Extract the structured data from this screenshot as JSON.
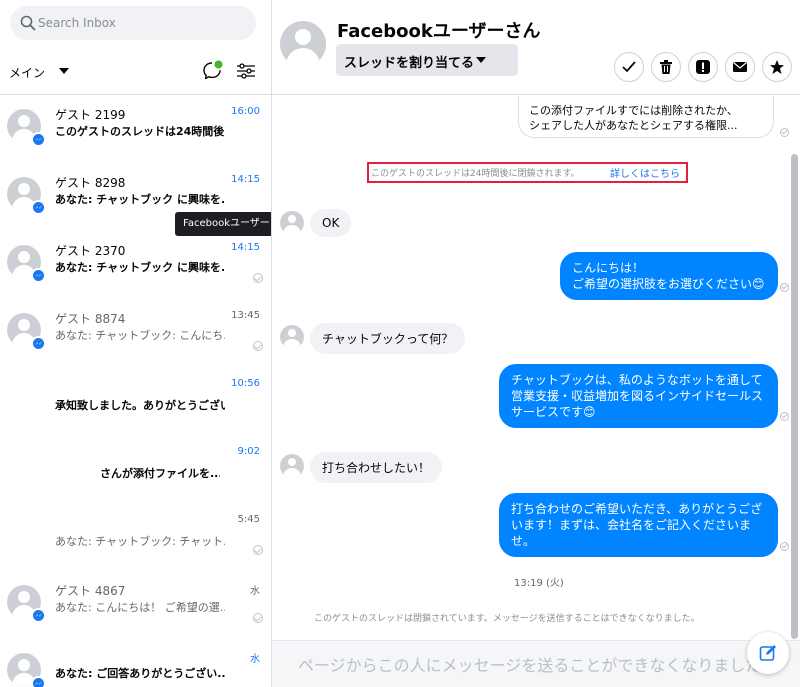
{
  "search": {
    "placeholder": "Search Inbox"
  },
  "filter": {
    "label": "メイン"
  },
  "conversations": [
    {
      "name": "ゲスト 2199",
      "preview": "このゲストのスレッドは24時間後...",
      "time": "16:00",
      "unread": true
    },
    {
      "name": "ゲスト 8298",
      "preview": "あなた: チャットブック に興味を...",
      "time": "14:15",
      "unread": true
    },
    {
      "name": "ゲスト 2370",
      "preview": "あなた: チャットブック に興味を...",
      "time": "14:15",
      "unread": true
    },
    {
      "name": "ゲスト 8874",
      "preview": "あなた: チャットブック: こんにち...",
      "time": "13:45",
      "unread": false
    },
    {
      "name": "",
      "preview": "承知致しました。ありがとうござい...",
      "time": "10:56",
      "unread": true
    },
    {
      "name": "",
      "preview": "さんが添付ファイルを...",
      "time": "9:02",
      "unread": true
    },
    {
      "name": "",
      "preview": "あなた: チャットブック: チャット...",
      "time": "5:45",
      "unread": false
    },
    {
      "name": "ゲスト 4867",
      "preview": "あなた: こんにちは！ ご希望の選...",
      "time": "水",
      "unread": false
    },
    {
      "name": "",
      "preview": "あなた: ご回答ありがとうござい...",
      "time": "水",
      "unread": true
    }
  ],
  "tooltip": "Facebookユーザー",
  "header": {
    "title": "Facebookユーザーさん",
    "assign_label": "スレッドを割り当てる"
  },
  "thread": {
    "quoted_line1": "この添付ファイルすでには削除されたか、",
    "quoted_line2": "シェアした人があなたとシェアする権限...",
    "notice": "このゲストのスレッドは24時間後に閉鎖されます。",
    "notice_link": "詳しくはこちら",
    "messages": [
      {
        "from": "guest",
        "text": "OK"
      },
      {
        "from": "page",
        "line1": "こんにちは！",
        "line2": "ご希望の選択肢をお選びください😊"
      },
      {
        "from": "guest",
        "text": "チャットブックって何？"
      },
      {
        "from": "page",
        "line1": "チャットブックは、私のようなボットを通して",
        "line2": "営業支援・収益増加を図るインサイドセールス",
        "line3": "サービスです😊"
      },
      {
        "from": "guest",
        "text": "打ち合わせしたい！"
      },
      {
        "from": "page",
        "line1": "打ち合わせのご希望いただき、ありがとうござ",
        "line2": "います！まずは、会社名をご記入くださいま",
        "line3": "せ。"
      }
    ],
    "timestamp": "13:19 (火)",
    "closed_note": "このゲストのスレッドは閉鎖されています。メッセージを送信することはできなくなりました。"
  },
  "composer": {
    "text": "ページからこの人にメッセージを送ることができなくなりました。"
  },
  "colors": {
    "accent": "#1877f2",
    "outgoing_bubble": "#0084ff",
    "incoming_bubble": "#f0f2f5",
    "notice_border": "#e41e3f"
  }
}
